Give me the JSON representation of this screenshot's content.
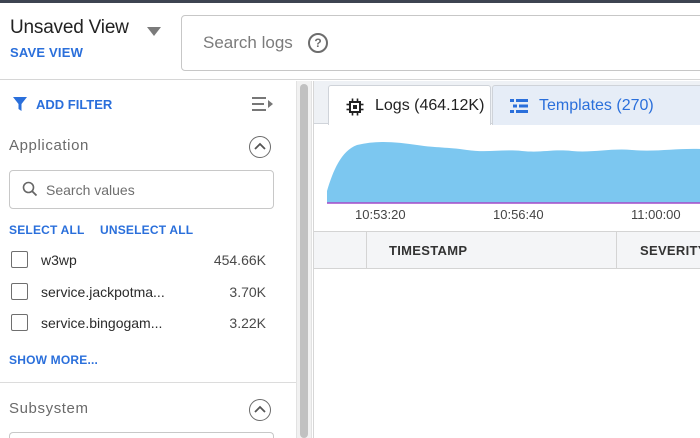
{
  "header": {
    "view_title": "Unsaved View",
    "save_view_label": "SAVE VIEW",
    "search_placeholder": "Search logs",
    "help_icon": "?"
  },
  "sidebar": {
    "add_filter_label": "ADD FILTER",
    "application": {
      "title": "Application",
      "search_placeholder": "Search values",
      "select_all_label": "SELECT ALL",
      "unselect_all_label": "UNSELECT ALL",
      "items": [
        {
          "label": "w3wp",
          "count": "454.66K",
          "checked": false
        },
        {
          "label": "service.jackpotma...",
          "count": "3.70K",
          "checked": false
        },
        {
          "label": "service.bingogam...",
          "count": "3.22K",
          "checked": false
        }
      ],
      "show_more_label": "SHOW MORE..."
    },
    "subsystem": {
      "title": "Subsystem"
    }
  },
  "main": {
    "tabs": [
      {
        "label": "Logs (464.12K)",
        "icon": "chip-icon",
        "active": true
      },
      {
        "label": "Templates (270)",
        "icon": "templates-icon",
        "active": false
      }
    ],
    "histogram": {
      "time_labels": [
        "10:53:20",
        "10:56:40",
        "11:00:00"
      ]
    },
    "table": {
      "columns": [
        "TIMESTAMP",
        "SEVERITY"
      ]
    }
  },
  "colors": {
    "accent": "#2a6fdb",
    "histogram_fill": "#7cc7f0",
    "histogram_baseline": "#a34bc8"
  }
}
